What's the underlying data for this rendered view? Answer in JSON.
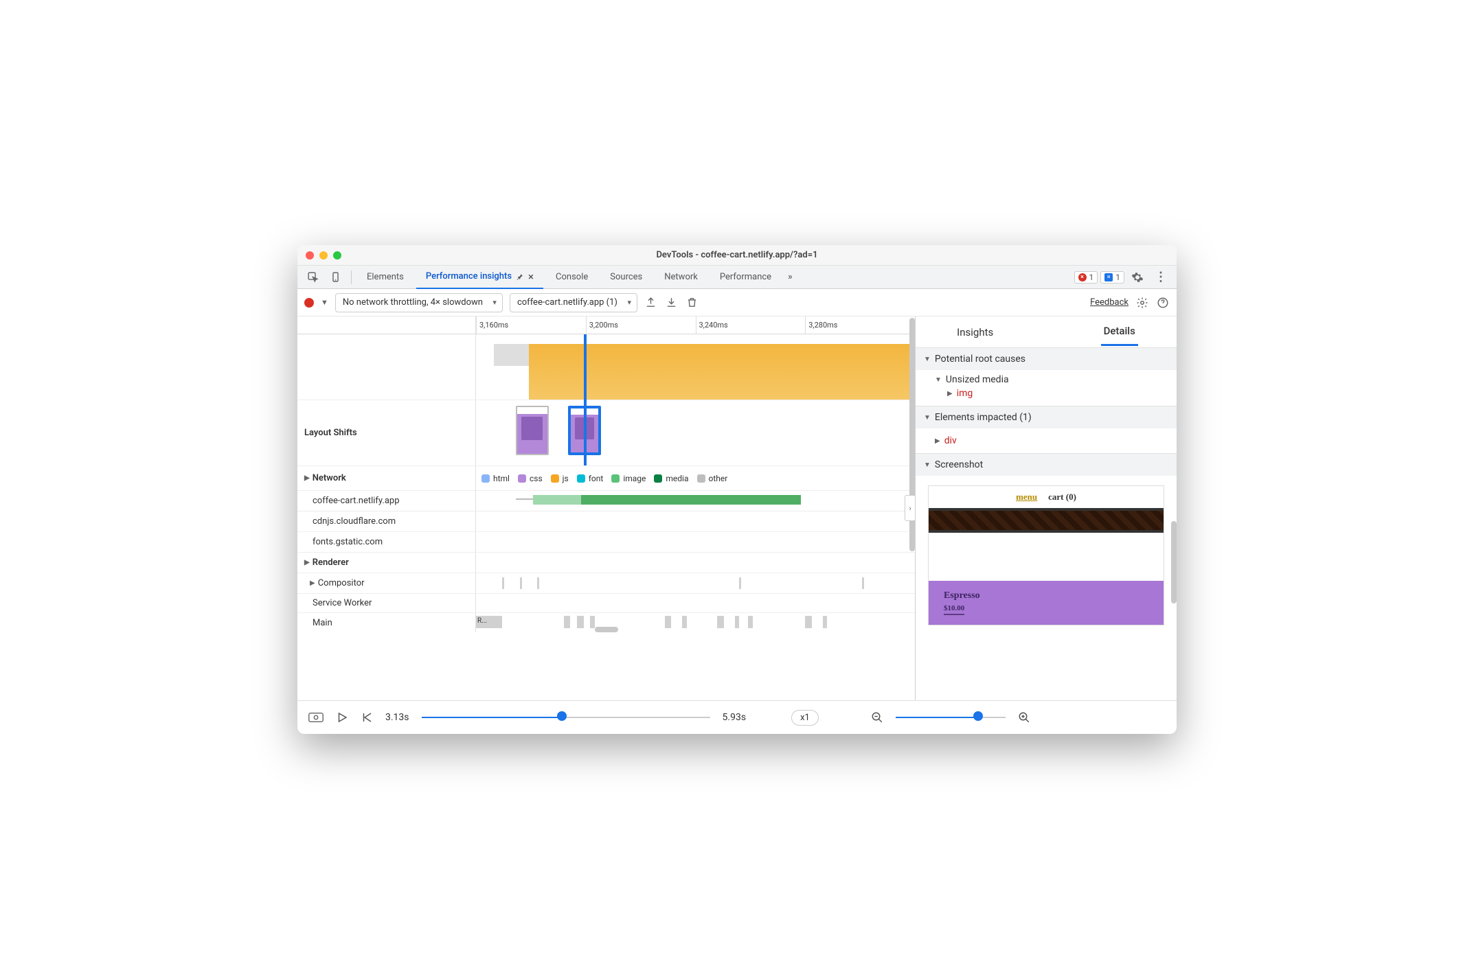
{
  "window": {
    "title": "DevTools - coffee-cart.netlify.app/?ad=1"
  },
  "tabs": {
    "items": [
      "Elements",
      "Performance insights",
      "Console",
      "Sources",
      "Network",
      "Performance"
    ],
    "active_index": 1,
    "errors_count": "1",
    "messages_count": "1"
  },
  "toolbar": {
    "throttling": "No network throttling, 4× slowdown",
    "target": "coffee-cart.netlify.app (1)",
    "feedback": "Feedback"
  },
  "ruler": [
    "3,160ms",
    "3,200ms",
    "3,240ms",
    "3,280ms"
  ],
  "tracks": {
    "layout_shifts": "Layout Shifts",
    "network": "Network",
    "hosts": [
      "coffee-cart.netlify.app",
      "cdnjs.cloudflare.com",
      "fonts.gstatic.com"
    ],
    "renderer": "Renderer",
    "renderer_rows": [
      "Compositor",
      "Service Worker",
      "Main"
    ],
    "main_task_label": "R..."
  },
  "legend": {
    "items": [
      {
        "label": "html",
        "color": "#8ab4f8"
      },
      {
        "label": "css",
        "color": "#b388d9"
      },
      {
        "label": "js",
        "color": "#f5a623"
      },
      {
        "label": "font",
        "color": "#00bcd4"
      },
      {
        "label": "image",
        "color": "#5bc27a"
      },
      {
        "label": "media",
        "color": "#0b8043"
      },
      {
        "label": "other",
        "color": "#bdbdbd"
      }
    ]
  },
  "details": {
    "tabs": [
      "Insights",
      "Details"
    ],
    "active_tab": 1,
    "root_causes": "Potential root causes",
    "unsized": "Unsized media",
    "unsized_tag": "img",
    "impacted": "Elements impacted (1)",
    "impacted_tag": "div",
    "screenshot_label": "Screenshot",
    "preview": {
      "menu": "menu",
      "cart": "cart (0)",
      "product": "Espresso",
      "price": "$10.00"
    }
  },
  "footer": {
    "start": "3.13s",
    "end": "5.93s",
    "speed": "x1"
  }
}
